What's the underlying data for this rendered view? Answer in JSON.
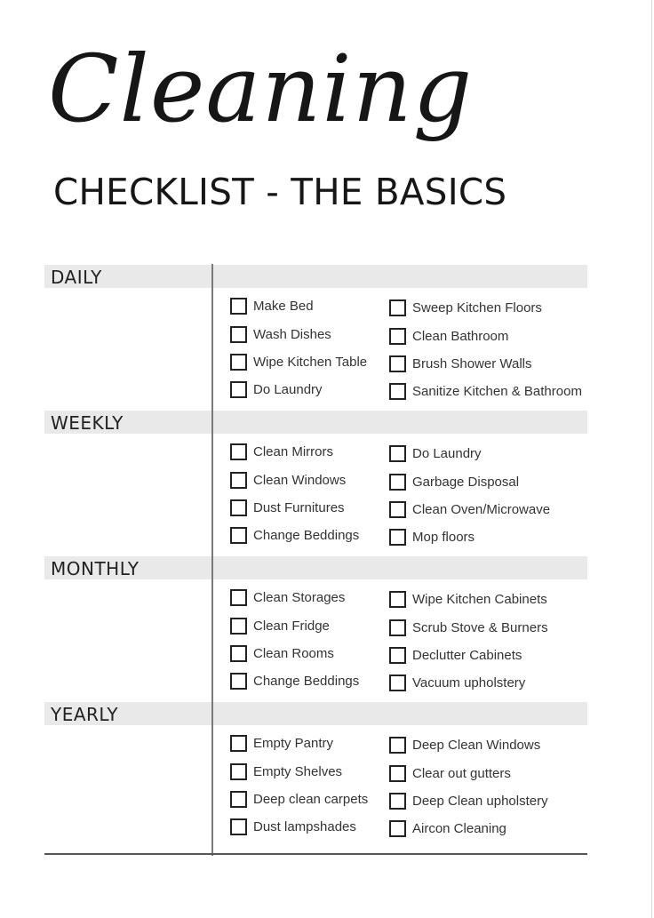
{
  "title": "Cleaning",
  "subtitle": "CHECKLIST - THE BASICS",
  "sections": [
    {
      "name": "DAILY",
      "col1": [
        "Make Bed",
        "Wash Dishes",
        "Wipe Kitchen Table",
        "Do Laundry"
      ],
      "col2": [
        "Sweep Kitchen Floors",
        "Clean Bathroom",
        "Brush Shower Walls",
        "Sanitize Kitchen & Bathroom"
      ]
    },
    {
      "name": "WEEKLY",
      "col1": [
        "Clean Mirrors",
        "Clean Windows",
        "Dust Furnitures",
        "Change Beddings"
      ],
      "col2": [
        "Do Laundry",
        "Garbage Disposal",
        "Clean Oven/Microwave",
        "Mop floors"
      ]
    },
    {
      "name": "MONTHLY",
      "col1": [
        "Clean Storages",
        "Clean Fridge",
        "Clean Rooms",
        "Change Beddings"
      ],
      "col2": [
        "Wipe Kitchen Cabinets",
        "Scrub Stove & Burners",
        "Declutter Cabinets",
        "Vacuum upholstery"
      ]
    },
    {
      "name": "YEARLY",
      "col1": [
        "Empty Pantry",
        "Empty Shelves",
        "Deep clean carpets",
        "Dust lampshades"
      ],
      "col2": [
        "Deep Clean Windows",
        "Clear out gutters",
        "Deep Clean upholstery",
        "Aircon Cleaning"
      ]
    }
  ],
  "colors": {
    "section_bar": "#e9e9e9",
    "text": "#1a1a1a",
    "divider": "#7a7a7a"
  }
}
